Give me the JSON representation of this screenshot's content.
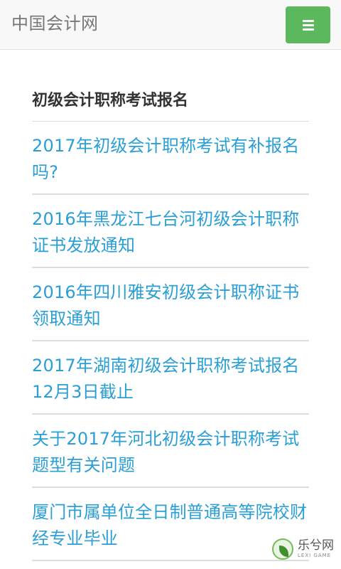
{
  "header": {
    "brand": "中国会计网",
    "menu_icon": "hamburger-icon",
    "menu_color": "#5cb85c"
  },
  "section": {
    "title": "初级会计职称考试报名",
    "link_color": "#2a9fd6"
  },
  "articles": [
    {
      "title": "2017年初级会计职称考试有补报名吗?"
    },
    {
      "title": "2016年黑龙江七台河初级会计职称证书发放通知"
    },
    {
      "title": "2016年四川雅安初级会计职称证书领取通知"
    },
    {
      "title": "2017年湖南初级会计职称考试报名12月3日截止"
    },
    {
      "title": "关于2017年河北初级会计职称考试题型有关问题"
    },
    {
      "title": "厦门市属单位全日制普通高等院校财经专业毕业"
    }
  ],
  "watermark": {
    "text": "乐兮网",
    "sub": "LEXI GAME",
    "icon": "leaf-logo-icon"
  }
}
